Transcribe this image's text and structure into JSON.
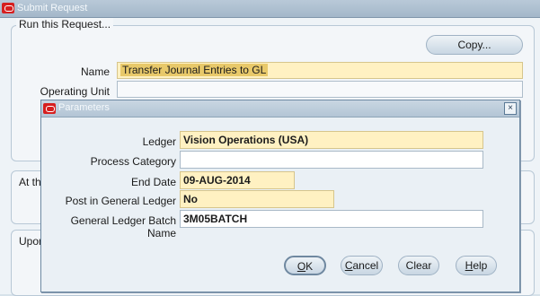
{
  "window": {
    "title": "Submit Request"
  },
  "run_group": {
    "label": "Run this Request...",
    "copy_label": "Copy...",
    "name_label": "Name",
    "name_value": "Transfer Journal Entries to GL",
    "operating_unit_label": "Operating Unit",
    "operating_unit_value": ""
  },
  "schedule_group": {
    "label_partial": "At th"
  },
  "upon_group": {
    "label_partial": "Upor"
  },
  "dialog": {
    "title": "Parameters",
    "close_glyph": "×",
    "fields": {
      "ledger": {
        "label": "Ledger",
        "value": "Vision Operations (USA)"
      },
      "process_category": {
        "label": "Process Category",
        "value": ""
      },
      "end_date": {
        "label": "End Date",
        "value": "09-AUG-2014"
      },
      "post_in_gl": {
        "label": "Post in General Ledger",
        "value": "No"
      },
      "gl_batch_name": {
        "label": "General Ledger Batch Name",
        "value": "3M05BATCH"
      }
    },
    "buttons": {
      "ok": {
        "mnemonic": "O",
        "rest": "K"
      },
      "cancel": {
        "mnemonic": "C",
        "rest": "ancel"
      },
      "clear": {
        "label": "Clear"
      },
      "help": {
        "mnemonic": "H",
        "rest": "elp"
      }
    }
  },
  "colors": {
    "required_field": "#fff1c2",
    "title_bar": "#a3b7c9",
    "oracle_logo": "#d61f1f"
  },
  "icons": {
    "window_logo": "oracle-logo-icon",
    "dialog_close": "close-icon"
  }
}
